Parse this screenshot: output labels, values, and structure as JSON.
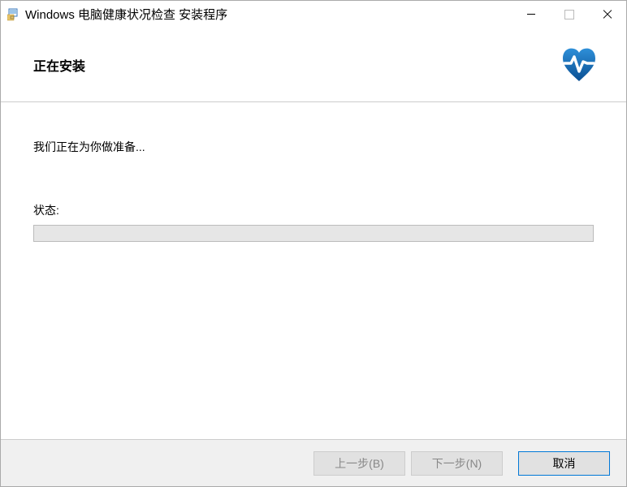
{
  "titlebar": {
    "title": "Windows 电脑健康状况检查 安装程序"
  },
  "header": {
    "title": "正在安装"
  },
  "content": {
    "preparing": "我们正在为你做准备...",
    "status_label": "状态:"
  },
  "footer": {
    "back": "上一步(B)",
    "next": "下一步(N)",
    "cancel": "取消"
  }
}
